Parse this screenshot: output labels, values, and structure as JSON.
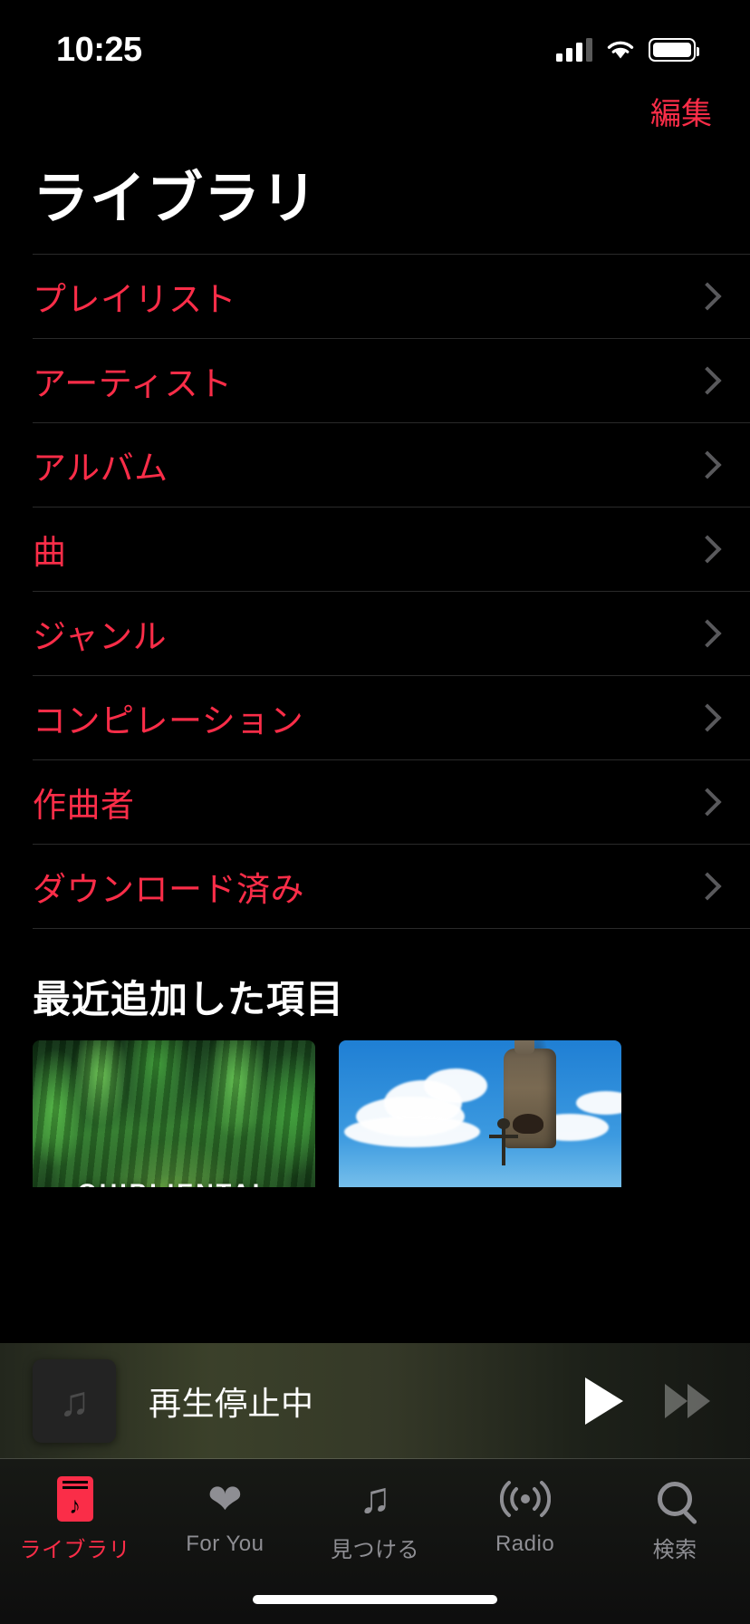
{
  "status_bar": {
    "time": "10:25",
    "signal_icon": "cellular-signal-icon",
    "wifi_icon": "wifi-icon",
    "battery_icon": "battery-icon"
  },
  "nav": {
    "edit_label": "編集"
  },
  "header": {
    "title": "ライブラリ"
  },
  "library_list": [
    {
      "label": "プレイリスト",
      "chevron": "chevron-right-icon"
    },
    {
      "label": "アーティスト",
      "chevron": "chevron-right-icon"
    },
    {
      "label": "アルバム",
      "chevron": "chevron-right-icon"
    },
    {
      "label": "曲",
      "chevron": "chevron-right-icon"
    },
    {
      "label": "ジャンル",
      "chevron": "chevron-right-icon"
    },
    {
      "label": "コンピレーション",
      "chevron": "chevron-right-icon"
    },
    {
      "label": "作曲者",
      "chevron": "chevron-right-icon"
    },
    {
      "label": "ダウンロード済み",
      "chevron": "chevron-right-icon"
    }
  ],
  "recently_added": {
    "section_title": "最近追加した項目",
    "albums": [
      {
        "name": "ghibliental-album-art",
        "overlay_text": "GHIBLIENTAL"
      },
      {
        "name": "howls-moving-castle-album-art",
        "overlay_text": ""
      }
    ]
  },
  "mini_player": {
    "artwork_icon": "music-note-icon",
    "title": "再生停止中",
    "play_label": "play-icon",
    "forward_label": "fast-forward-icon"
  },
  "tab_bar": {
    "items": [
      {
        "label": "ライブラリ",
        "icon": "library-icon",
        "active": true
      },
      {
        "label": "For You",
        "icon": "heart-icon",
        "active": false
      },
      {
        "label": "見つける",
        "icon": "music-note-icon",
        "active": false
      },
      {
        "label": "Radio",
        "icon": "radio-waves-icon",
        "active": false
      },
      {
        "label": "検索",
        "icon": "search-icon",
        "active": false
      }
    ]
  },
  "colors": {
    "accent": "#fa2d48",
    "background": "#000000",
    "text_primary": "#ffffff",
    "text_secondary": "#8e8e93",
    "separator": "#2a2a2a"
  }
}
